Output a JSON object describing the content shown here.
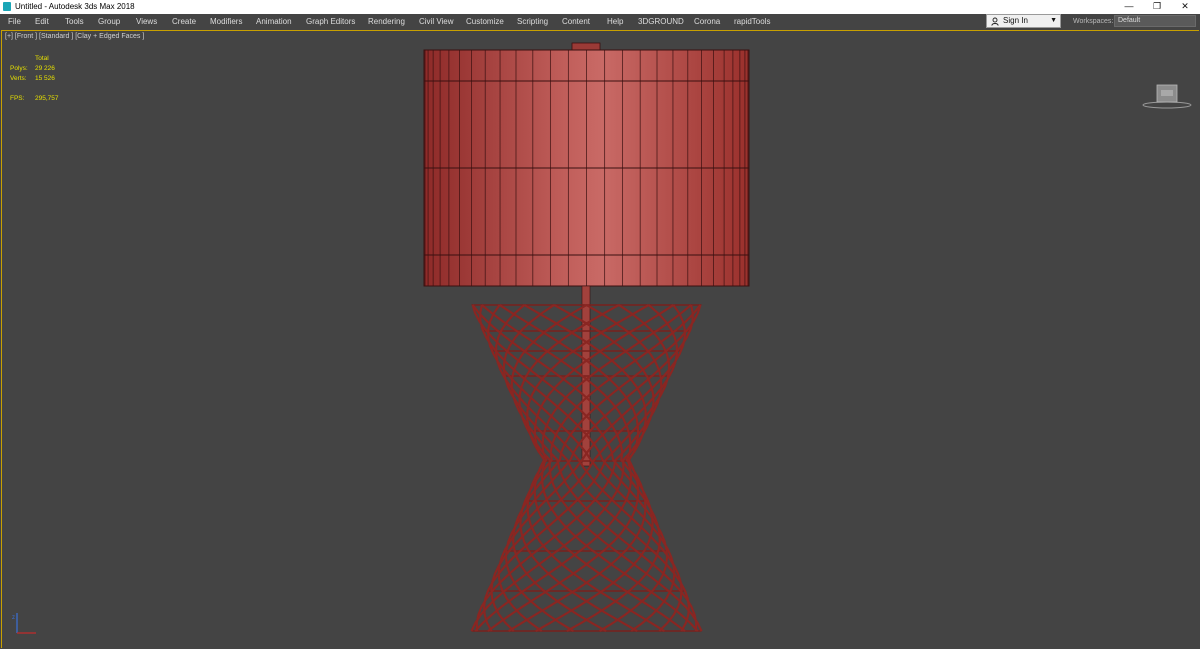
{
  "window": {
    "title": "Untitled - Autodesk 3ds Max 2018",
    "minimize": "—",
    "maximize": "❐",
    "close": "✕"
  },
  "menu": {
    "items": [
      "File",
      "Edit",
      "Tools",
      "Group",
      "Views",
      "Create",
      "Modifiers",
      "Animation",
      "Graph Editors",
      "Rendering",
      "Civil View",
      "Customize",
      "Scripting",
      "Content",
      "Help",
      "3DGROUND",
      "Corona",
      "rapidTools"
    ]
  },
  "signin": {
    "label": "Sign In"
  },
  "workspaces": {
    "label": "Workspaces:",
    "value": "Default"
  },
  "viewport": {
    "label": "[+] [Front ] [Standard ] [Clay + Edged Faces ]",
    "stats": {
      "header": "Total",
      "polys_label": "Polys:",
      "polys_value": "29 226",
      "verts_label": "Verts:",
      "verts_value": "15 526",
      "fps_label": "FPS:",
      "fps_value": "295,757"
    }
  },
  "colors": {
    "accent_border": "#c8a000",
    "stats_text": "#e6e000",
    "model_red": "#b33a36"
  },
  "icons": [
    "app-icon",
    "user-icon",
    "viewcube-icon",
    "axis-tripod-icon"
  ]
}
